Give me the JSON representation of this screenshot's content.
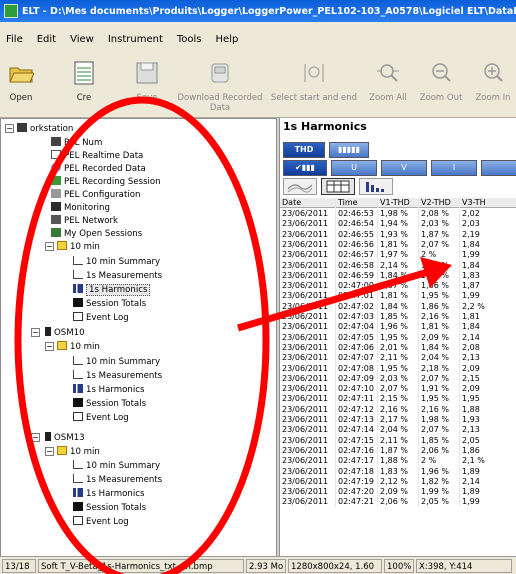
{
  "window": {
    "title": "ELT - D:\\Mes documents\\Produits\\Logger\\LoggerPower_PEL102-103_A0578\\Logiciel ELT\\DataFiles\\24h-10"
  },
  "menu": [
    "File",
    "Edit",
    "View",
    "Instrument",
    "Tools",
    "Help"
  ],
  "toolbar": {
    "open": "Open",
    "create": "Cre",
    "save": "Save",
    "download1": "Download Recorded",
    "download2": "Data",
    "select": "Select start and end",
    "zoom_all": "Zoom All",
    "zoom_out": "Zoom Out",
    "zoom_in": "Zoom In"
  },
  "tree": {
    "workstation": "orkstation",
    "pel_num": "PEL Num",
    "realtime": "PEL Realtime Data",
    "recorded": "PEL Recorded Data",
    "recording_session": "PEL Recording Session",
    "configuration": "PEL Configuration",
    "monitoring": "Monitoring",
    "network": "PEL Network",
    "my_open_sessions": "My Open Sessions",
    "s1": {
      "folder": "10 min",
      "summary": "10 min Summary",
      "measurements": "1s Measurements",
      "harmonics": "1s Harmonics",
      "totals": "Session Totals",
      "log": "Event Log"
    },
    "osm10": "OSM10",
    "s2": {
      "folder": "10 min",
      "summary": "10 min Summary",
      "measurements": "1s Measurements",
      "harmonics": "1s Harmonics",
      "totals": "Session Totals",
      "log": "Event Log"
    },
    "osm13": "OSM13",
    "s3": {
      "folder": "10 min",
      "summary": "10 min Summary",
      "measurements": "1s Measurements",
      "harmonics": "1s Harmonics",
      "totals": "Session Totals",
      "log": "Event Log"
    }
  },
  "panel": {
    "title": "1s Harmonics",
    "thd": "THD",
    "u": "U",
    "v": "V",
    "i": "I"
  },
  "table": {
    "headers": [
      "Date",
      "Time",
      "V1-THD",
      "V2-THD",
      "V3-TH"
    ],
    "rows": [
      [
        "23/06/2011",
        "02:46:53",
        "1,98 %",
        "2,08 %",
        "2,02"
      ],
      [
        "23/06/2011",
        "02:46:54",
        "1,94 %",
        "2,03 %",
        "2,03"
      ],
      [
        "23/06/2011",
        "02:46:55",
        "1,93 %",
        "1,87 %",
        "2,19"
      ],
      [
        "23/06/2011",
        "02:46:56",
        "1,81 %",
        "2,07 %",
        "1,84"
      ],
      [
        "23/06/2011",
        "02:46:57",
        "1,97 %",
        "2 %",
        "1,99"
      ],
      [
        "23/06/2011",
        "02:46:58",
        "2,14 %",
        "1,94 %",
        "1,84"
      ],
      [
        "23/06/2011",
        "02:46:59",
        "1,84 %",
        "1,89 %",
        "1,83"
      ],
      [
        "23/06/2011",
        "02:47:00",
        "1,87 %",
        "1,86 %",
        "1,87"
      ],
      [
        "23/06/2011",
        "02:47:01",
        "1,81 %",
        "1,95 %",
        "1,99"
      ],
      [
        "23/06/2011",
        "02:47:02",
        "1,84 %",
        "1,86 %",
        "2,2 %"
      ],
      [
        "23/06/2011",
        "02:47:03",
        "1,85 %",
        "2,16 %",
        "1,81"
      ],
      [
        "23/06/2011",
        "02:47:04",
        "1,96 %",
        "1,81 %",
        "1,84"
      ],
      [
        "23/06/2011",
        "02:47:05",
        "1,95 %",
        "2,09 %",
        "2,14"
      ],
      [
        "23/06/2011",
        "02:47:06",
        "2,01 %",
        "1,84 %",
        "2,08"
      ],
      [
        "23/06/2011",
        "02:47:07",
        "2,11 %",
        "2,04 %",
        "2,13"
      ],
      [
        "23/06/2011",
        "02:47:08",
        "1,95 %",
        "2,18 %",
        "2,09"
      ],
      [
        "23/06/2011",
        "02:47:09",
        "2,03 %",
        "2,07 %",
        "2,15"
      ],
      [
        "23/06/2011",
        "02:47:10",
        "2,07 %",
        "1,91 %",
        "2,09"
      ],
      [
        "23/06/2011",
        "02:47:11",
        "2,15 %",
        "1,95 %",
        "1,95"
      ],
      [
        "23/06/2011",
        "02:47:12",
        "2,16 %",
        "2,16 %",
        "1,88"
      ],
      [
        "23/06/2011",
        "02:47:13",
        "2,17 %",
        "1,98 %",
        "1,93"
      ],
      [
        "23/06/2011",
        "02:47:14",
        "2,04 %",
        "2,07 %",
        "2,13"
      ],
      [
        "23/06/2011",
        "02:47:15",
        "2,11 %",
        "1,85 %",
        "2,05"
      ],
      [
        "23/06/2011",
        "02:47:16",
        "1,87 %",
        "2,06 %",
        "1,86"
      ],
      [
        "23/06/2011",
        "02:47:17",
        "1,88 %",
        "2 %",
        "2,1 %"
      ],
      [
        "23/06/2011",
        "02:47:18",
        "1,83 %",
        "1,96 %",
        "1,89"
      ],
      [
        "23/06/2011",
        "02:47:19",
        "2,12 %",
        "1,82 %",
        "2,14"
      ],
      [
        "23/06/2011",
        "02:47:20",
        "2,09 %",
        "1,99 %",
        "1,89"
      ],
      [
        "23/06/2011",
        "02:47:21",
        "2,06 %",
        "2,05 %",
        "1,99"
      ]
    ]
  },
  "status": {
    "index": "13/18",
    "filename": "Soft   T_V-Beta_1s-Harmonics_txt_en.bmp",
    "size": "2.93 Mo",
    "dims": "1280x800x24, 1.60",
    "zoom": "100%",
    "coords": "X:398, Y:414"
  },
  "colors": {
    "annotation": "#ff0000",
    "title_blue": "#0a5ed8",
    "button_blue": "#2c62c4"
  }
}
